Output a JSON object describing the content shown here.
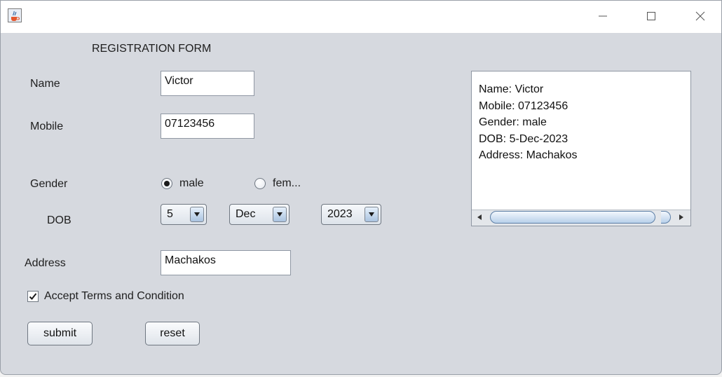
{
  "window": {
    "title": ""
  },
  "form": {
    "heading": "REGISTRATION FORM",
    "name_label": "Name",
    "name_value": "Victor",
    "mobile_label": "Mobile",
    "mobile_value": "07123456",
    "gender_label": "Gender",
    "gender_options": [
      "male",
      "fem..."
    ],
    "gender_selected": "male",
    "dob_label": "DOB",
    "dob_day": "5",
    "dob_month": "Dec",
    "dob_year": "2023",
    "address_label": "Address",
    "address_value": "Machakos",
    "terms_label": "Accept Terms and Condition",
    "terms_checked": true,
    "submit_label": "submit",
    "reset_label": "reset"
  },
  "output": {
    "lines": [
      "Name: Victor",
      "Mobile: 07123456",
      "Gender: male",
      "DOB: 5-Dec-2023",
      "Address: Machakos"
    ]
  },
  "icons": {
    "app": "java-cup-icon",
    "minimize": "minimize-icon",
    "maximize": "maximize-icon",
    "close": "close-icon"
  },
  "colors": {
    "window_bg": "#d6d9df",
    "titlebar_bg": "#ffffff",
    "accent": "#5d7fa6"
  }
}
